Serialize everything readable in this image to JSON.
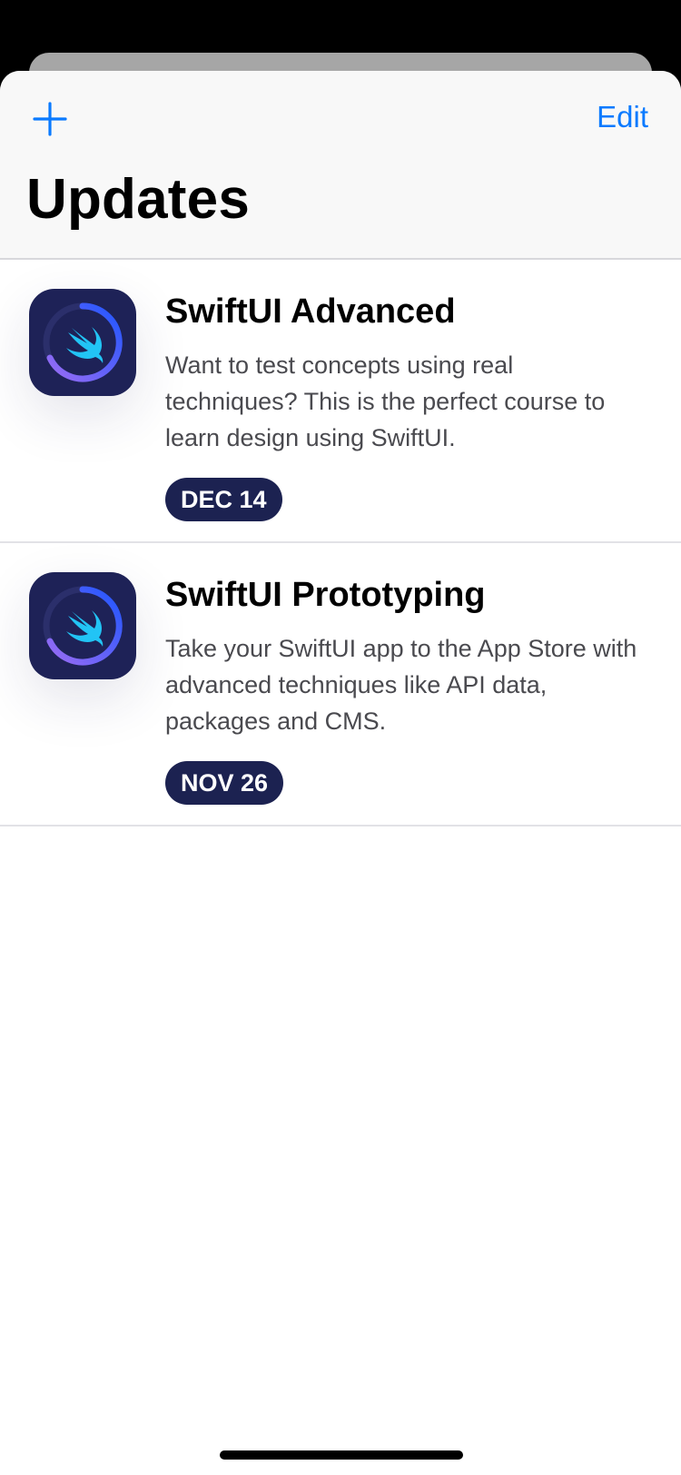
{
  "nav": {
    "add_icon": "plus-icon",
    "edit_label": "Edit",
    "title": "Updates"
  },
  "updates": [
    {
      "title": "SwiftUI Advanced",
      "description": "Want to test concepts using real techniques? This is the perfect course to learn design using SwiftUI.",
      "date": "DEC 14",
      "icon": "swift-logo-icon"
    },
    {
      "title": "SwiftUI Prototyping",
      "description": "Take your SwiftUI app to the App Store with advanced techniques like API data, packages and CMS.",
      "date": "NOV 26",
      "icon": "swift-logo-icon"
    }
  ],
  "colors": {
    "accent": "#0a7aff",
    "badge_bg": "#1c2251",
    "icon_bg": "#1e2257",
    "ring_start": "#2f5bff",
    "ring_end": "#8b6cf6",
    "swift_bird": "#22c4f5"
  }
}
